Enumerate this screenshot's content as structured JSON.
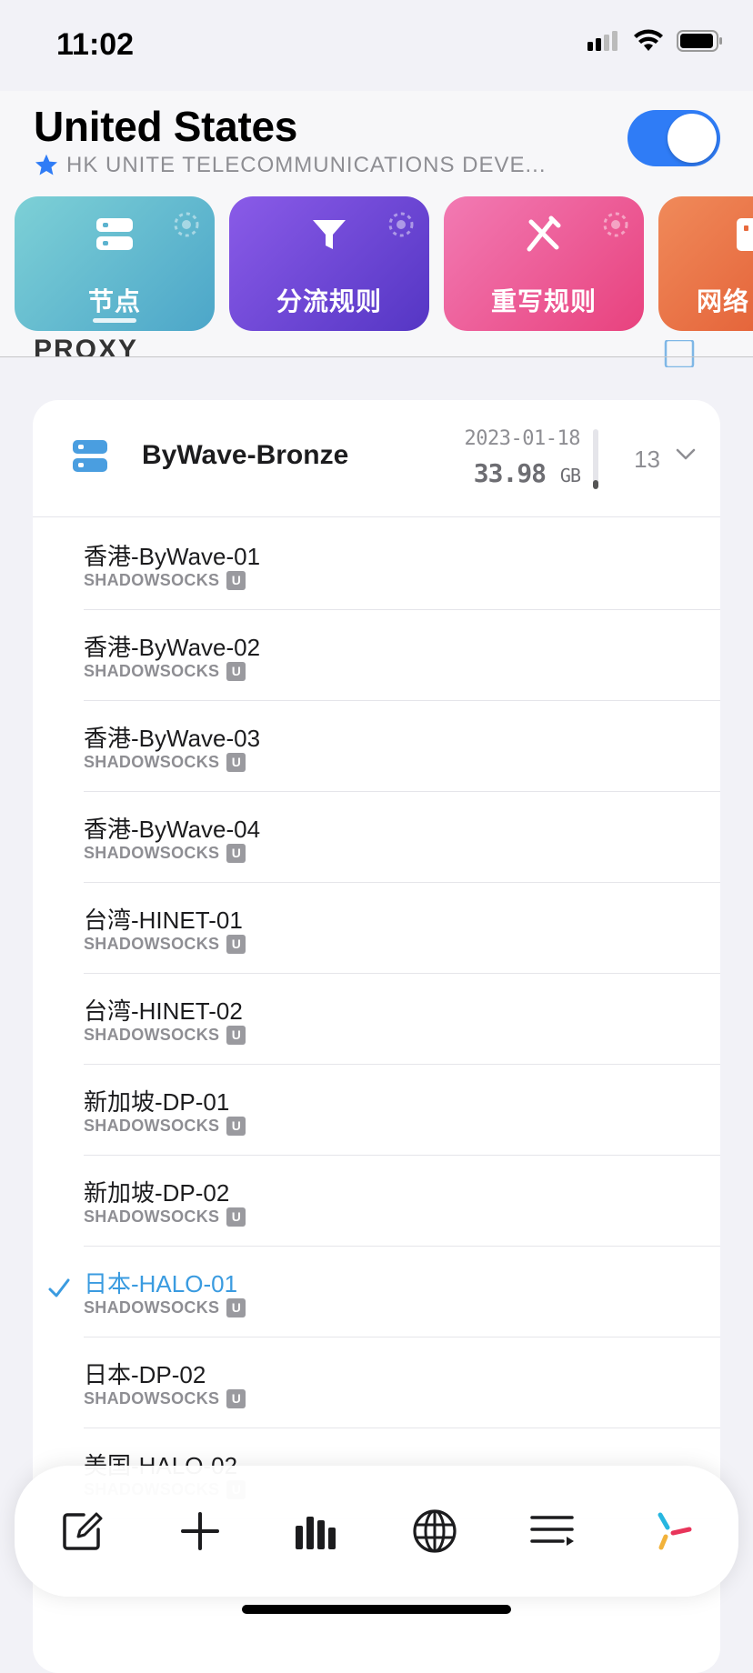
{
  "status_bar": {
    "time": "11:02"
  },
  "header": {
    "title": "United States",
    "subtitle": "HK UNITE TELECOMMUNICATIONS DEVE..."
  },
  "cards": [
    {
      "label": "节点",
      "icon": "server-icon"
    },
    {
      "label": "分流规则",
      "icon": "filter-icon"
    },
    {
      "label": "重写规则",
      "icon": "pen-tool-icon"
    },
    {
      "label": "网络",
      "icon": "network-icon"
    }
  ],
  "section_title": "PROXY",
  "group": {
    "name": "ByWave-Bronze",
    "date": "2023-01-18",
    "usage_value": "33.98",
    "usage_unit": "GB",
    "usage_fraction": 0.15,
    "count": "13"
  },
  "nodes": [
    {
      "name": "香港-ByWave-01",
      "type": "SHADOWSOCKS",
      "badge": "U",
      "selected": false
    },
    {
      "name": "香港-ByWave-02",
      "type": "SHADOWSOCKS",
      "badge": "U",
      "selected": false
    },
    {
      "name": "香港-ByWave-03",
      "type": "SHADOWSOCKS",
      "badge": "U",
      "selected": false
    },
    {
      "name": "香港-ByWave-04",
      "type": "SHADOWSOCKS",
      "badge": "U",
      "selected": false
    },
    {
      "name": "台湾-HINET-01",
      "type": "SHADOWSOCKS",
      "badge": "U",
      "selected": false
    },
    {
      "name": "台湾-HINET-02",
      "type": "SHADOWSOCKS",
      "badge": "U",
      "selected": false
    },
    {
      "name": "新加坡-DP-01",
      "type": "SHADOWSOCKS",
      "badge": "U",
      "selected": false
    },
    {
      "name": "新加坡-DP-02",
      "type": "SHADOWSOCKS",
      "badge": "U",
      "selected": false
    },
    {
      "name": "日本-HALO-01",
      "type": "SHADOWSOCKS",
      "badge": "U",
      "selected": true
    },
    {
      "name": "日本-DP-02",
      "type": "SHADOWSOCKS",
      "badge": "U",
      "selected": false
    },
    {
      "name": "美国-HALO-02",
      "type": "SHADOWSOCKS",
      "badge": "U",
      "selected": false
    }
  ],
  "tabbar": [
    {
      "icon": "edit-icon"
    },
    {
      "icon": "plus-icon"
    },
    {
      "icon": "stats-icon"
    },
    {
      "icon": "globe-icon"
    },
    {
      "icon": "playlist-icon"
    },
    {
      "icon": "app-logo-icon"
    }
  ],
  "colors": {
    "accent": "#2f7cf6",
    "selected_text": "#3a9be0"
  }
}
